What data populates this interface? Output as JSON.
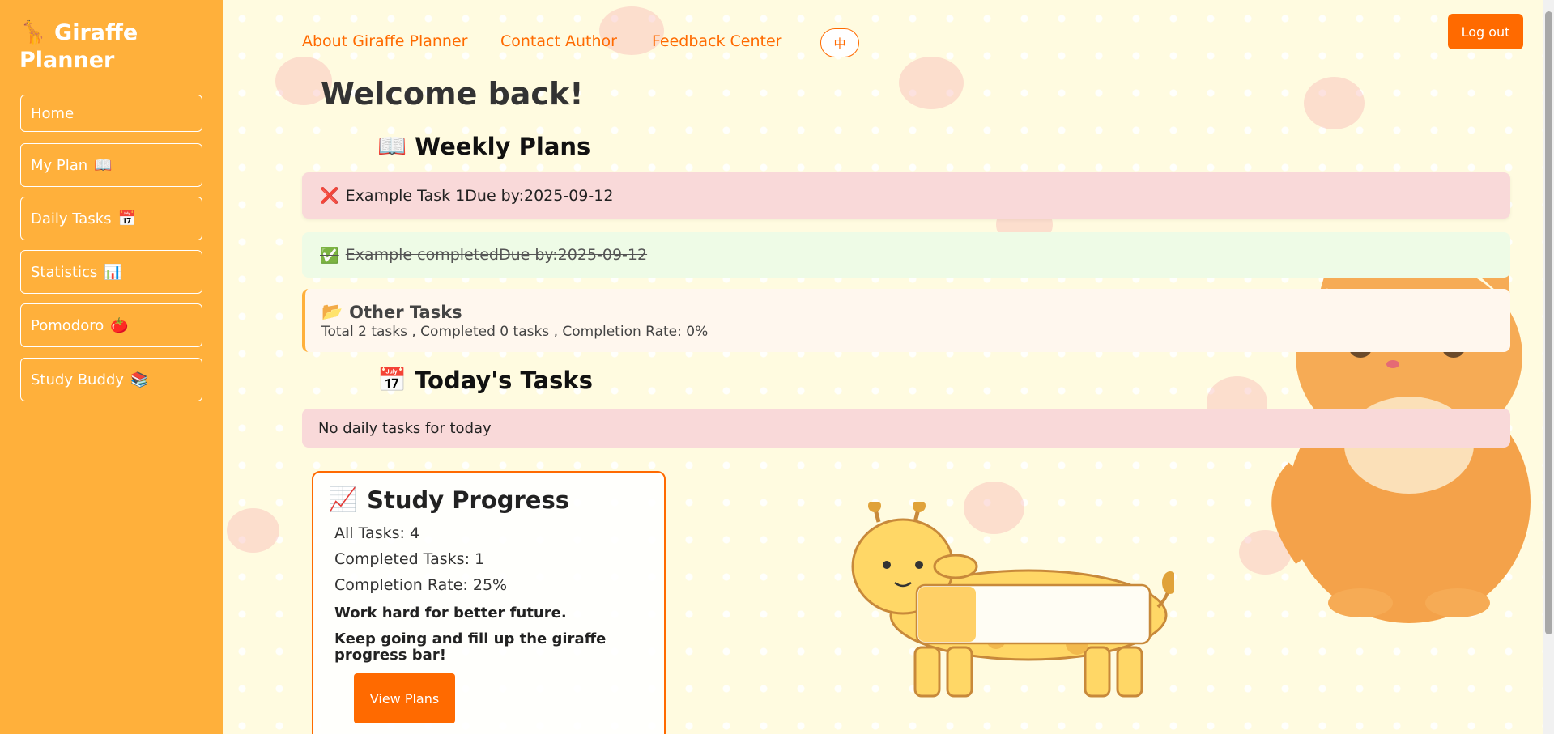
{
  "brand": {
    "icon": "🦒",
    "name": "Giraffe Planner"
  },
  "sidebar": {
    "items": [
      {
        "label": "Home",
        "icon": ""
      },
      {
        "label": "My Plan",
        "icon": "📖"
      },
      {
        "label": "Daily Tasks",
        "icon": "📅"
      },
      {
        "label": "Statistics",
        "icon": "📊"
      },
      {
        "label": "Pomodoro",
        "icon": "🍅"
      },
      {
        "label": "Study Buddy",
        "icon": "📚"
      }
    ]
  },
  "topnav": {
    "about": "About Giraffe Planner",
    "contact": "Contact Author",
    "feedback": "Feedback Center",
    "lang": "中",
    "logout": "Log out"
  },
  "welcome": "Welcome back!",
  "weekly": {
    "title": "Weekly Plans",
    "icon": "📖",
    "tasks": [
      {
        "status_icon": "❌",
        "text": "Example Task 1Due by:2025-09-12"
      },
      {
        "status_icon": "✅",
        "text": "Example completedDue by:2025-09-12"
      }
    ],
    "other": {
      "icon": "📂",
      "title": "Other Tasks",
      "stats": "Total 2 tasks , Completed 0 tasks , Completion Rate: 0%"
    }
  },
  "today": {
    "title": "Today's Tasks",
    "icon": "📅",
    "empty": "No daily tasks for today"
  },
  "progress": {
    "icon": "📈",
    "title": "Study Progress",
    "all": "All Tasks: 4",
    "completed": "Completed Tasks: 1",
    "rate": "Completion Rate: 25%",
    "motto1": "Work hard for better future.",
    "motto2": "Keep going and fill up the giraffe progress bar!",
    "button": "View Plans",
    "fill_fraction": 0.25
  },
  "colors": {
    "sidebar": "#ffb03b",
    "accent": "#ff6a00"
  }
}
